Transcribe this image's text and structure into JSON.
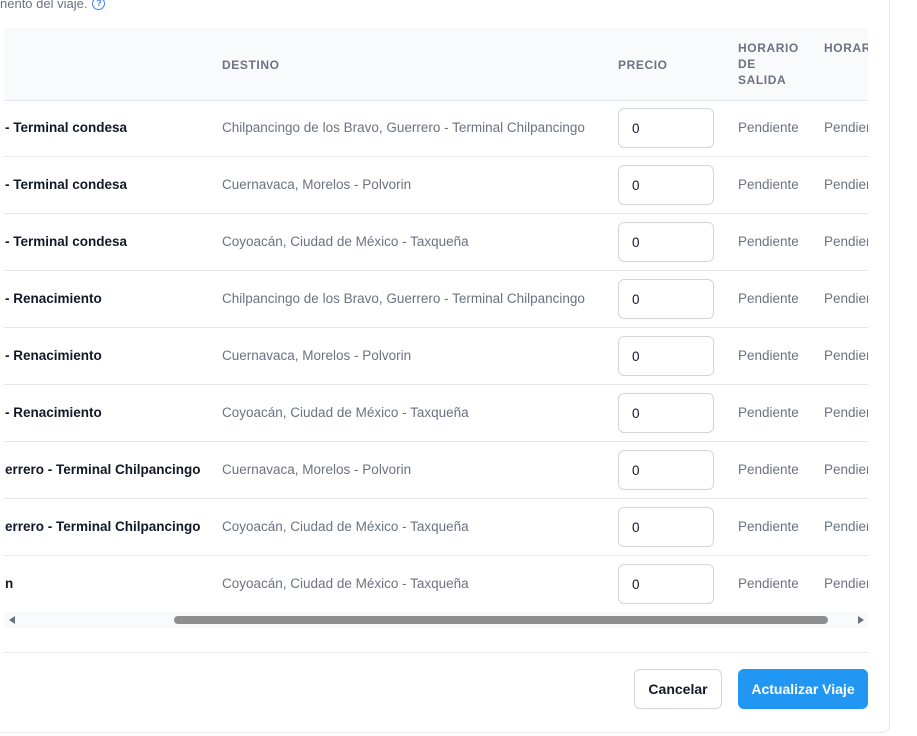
{
  "hint": {
    "text": "nento del viaje.",
    "icon": "question-circle-icon"
  },
  "table": {
    "headers": {
      "destino": "DESTINO",
      "precio": "PRECIO",
      "salida": "HORARIO DE SALIDA",
      "llegada": "HORARIO DE LLEGADA"
    },
    "rows": [
      {
        "origin": "- Terminal condesa",
        "dest": "Chilpancingo de los Bravo, Guerrero - Terminal Chilpancingo",
        "price": "0",
        "salida": "Pendiente",
        "llegada": "Pendiente"
      },
      {
        "origin": "- Terminal condesa",
        "dest": "Cuernavaca, Morelos - Polvorin",
        "price": "0",
        "salida": "Pendiente",
        "llegada": "Pendiente"
      },
      {
        "origin": "- Terminal condesa",
        "dest": "Coyoacán, Ciudad de México - Taxqueña",
        "price": "0",
        "salida": "Pendiente",
        "llegada": "Pendiente"
      },
      {
        "origin": "- Renacimiento",
        "dest": "Chilpancingo de los Bravo, Guerrero - Terminal Chilpancingo",
        "price": "0",
        "salida": "Pendiente",
        "llegada": "Pendiente"
      },
      {
        "origin": "- Renacimiento",
        "dest": "Cuernavaca, Morelos - Polvorin",
        "price": "0",
        "salida": "Pendiente",
        "llegada": "Pendiente"
      },
      {
        "origin": "- Renacimiento",
        "dest": "Coyoacán, Ciudad de México - Taxqueña",
        "price": "0",
        "salida": "Pendiente",
        "llegada": "Pendiente"
      },
      {
        "origin": "errero - Terminal Chilpancingo",
        "dest": "Cuernavaca, Morelos - Polvorin",
        "price": "0",
        "salida": "Pendiente",
        "llegada": "Pendiente"
      },
      {
        "origin": "errero - Terminal Chilpancingo",
        "dest": "Coyoacán, Ciudad de México - Taxqueña",
        "price": "0",
        "salida": "Pendiente",
        "llegada": "Pendiente"
      },
      {
        "origin": "n",
        "dest": "Coyoacán, Ciudad de México - Taxqueña",
        "price": "0",
        "salida": "Pendiente",
        "llegada": "Pendiente"
      }
    ]
  },
  "footer": {
    "cancel_label": "Cancelar",
    "update_label": "Actualizar Viaje"
  },
  "colors": {
    "primary": "#2196f3",
    "muted_text": "#6b7280",
    "header_bg": "#f9fafb",
    "border": "#e5e7eb"
  }
}
